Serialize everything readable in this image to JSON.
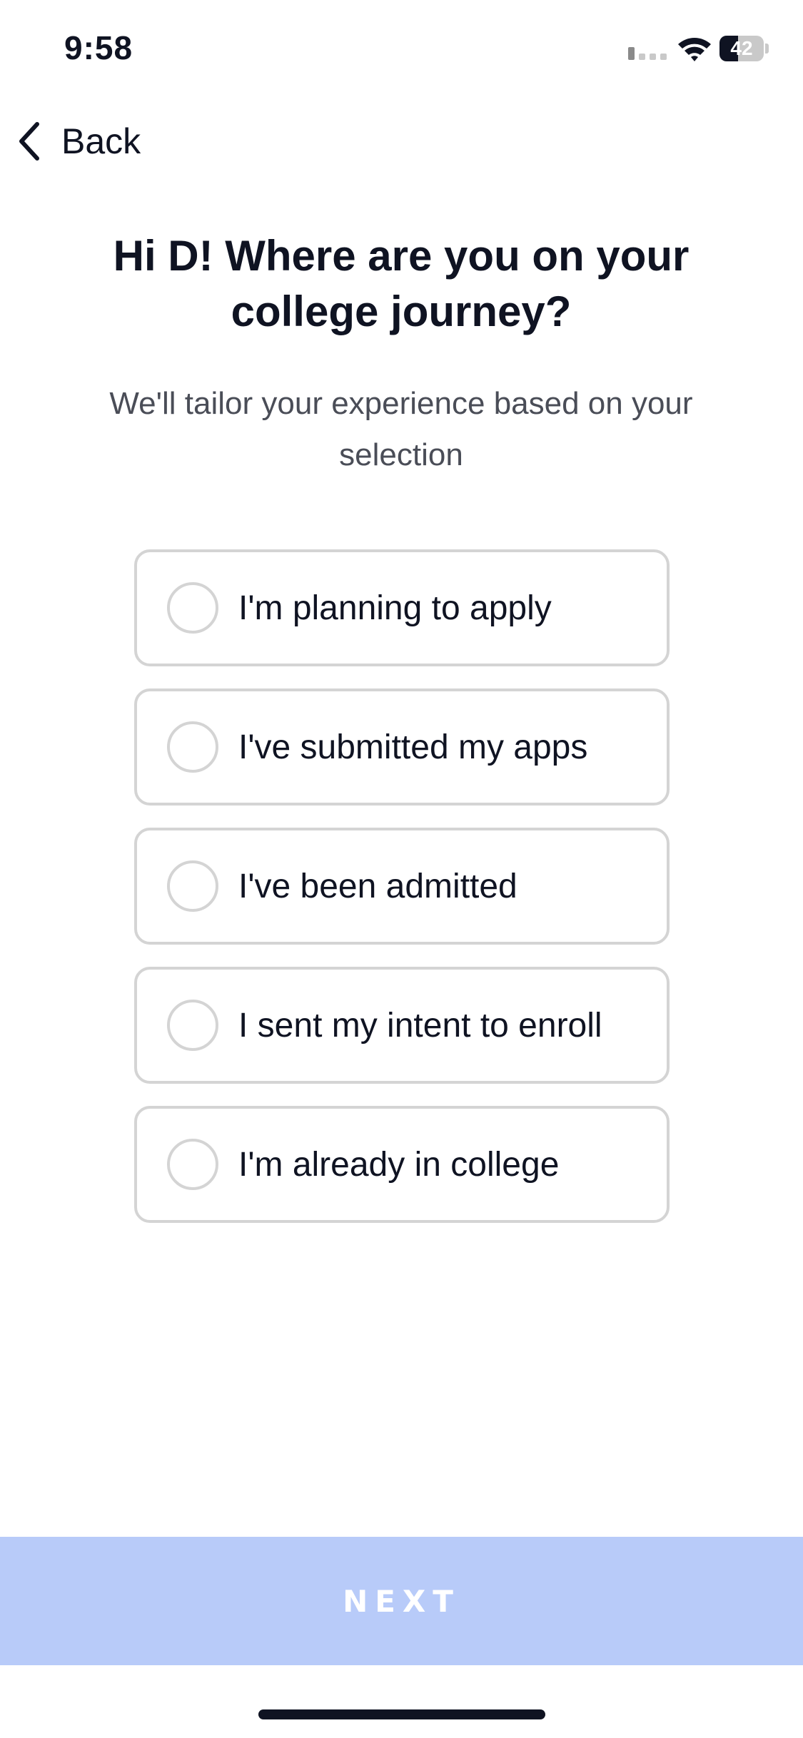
{
  "status_bar": {
    "time": "9:58",
    "battery_level": "42",
    "battery_fraction": 0.42,
    "icons": [
      "signal-icon",
      "wifi-icon",
      "battery-icon"
    ]
  },
  "nav": {
    "back_label": "Back",
    "back_icon": "chevron-left-icon"
  },
  "header": {
    "title": "Hi D! Where are you on your college journey?",
    "subtitle": "We'll tailor your experience based on your selection"
  },
  "options": [
    {
      "label": "I'm planning to apply",
      "selected": false
    },
    {
      "label": "I've submitted my apps",
      "selected": false
    },
    {
      "label": "I've been admitted",
      "selected": false
    },
    {
      "label": "I sent my intent to enroll",
      "selected": false
    },
    {
      "label": "I'm already in college",
      "selected": false
    }
  ],
  "footer": {
    "next_label": "NEXT",
    "next_enabled": false
  },
  "colors": {
    "text_primary": "#0f1322",
    "text_secondary": "#4a4d57",
    "option_border": "#d4d4d4",
    "next_disabled_bg": "#b8cbf9"
  }
}
